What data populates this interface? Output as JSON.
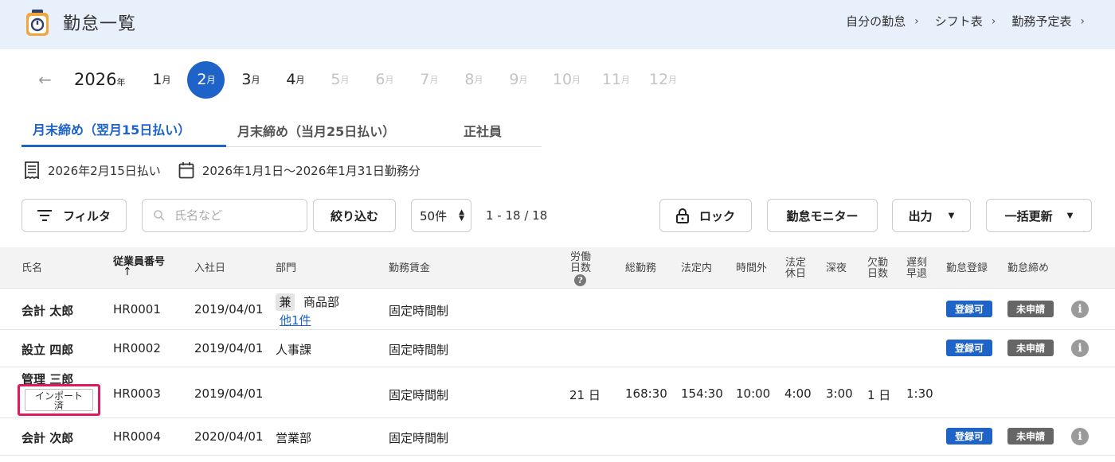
{
  "header": {
    "title": "勤怠一覧",
    "links": [
      {
        "label": "自分の勤怠"
      },
      {
        "label": "シフト表"
      },
      {
        "label": "勤務予定表"
      }
    ]
  },
  "months": {
    "year": "2026",
    "year_suffix": "年",
    "month_suffix": "月",
    "items": [
      "1",
      "2",
      "3",
      "4",
      "5",
      "6",
      "7",
      "8",
      "9",
      "10",
      "11",
      "12"
    ],
    "selected": "2"
  },
  "tabs": [
    {
      "label": "月末締め（翌月15日払い）",
      "active": true
    },
    {
      "label": "月末締め（当月25日払い）",
      "active": false
    },
    {
      "label": "正社員",
      "active": false
    }
  ],
  "info": {
    "payday": "2026年2月15日払い",
    "period": "2026年1月1日〜2026年1月31日勤務分"
  },
  "toolbar": {
    "filter_label": "フィルタ",
    "search_placeholder": "氏名など",
    "narrow_label": "絞り込む",
    "per_page": "50件",
    "range": "1 - 18 / 18",
    "lock_label": "ロック",
    "monitor_label": "勤怠モニター",
    "export_label": "出力",
    "bulk_label": "一括更新"
  },
  "table": {
    "headers": {
      "name": "氏名",
      "emp_no": "従業員番号",
      "sort_arrow": "↑",
      "hire_date": "入社日",
      "dept": "部門",
      "wage": "勤務賃金",
      "workdays_1": "労働",
      "workdays_2": "日数",
      "total": "総勤務",
      "legal": "法定内",
      "overtime": "時間外",
      "holiday_1": "法定",
      "holiday_2": "休日",
      "night": "深夜",
      "absence_1": "欠勤",
      "absence_2": "日数",
      "late_1": "遅刻",
      "late_2": "早退",
      "reg": "勤怠登録",
      "close": "勤怠締め"
    },
    "rows": [
      {
        "name": "会計 太郎",
        "emp_no": "HR0001",
        "hire_date": "2019/04/01",
        "dept_tag": "兼",
        "dept": "商品部",
        "dept_more": "他1件",
        "wage": "固定時間制",
        "reg": "登録可",
        "close": "未申請"
      },
      {
        "name": "設立 四郎",
        "emp_no": "HR0002",
        "hire_date": "2019/04/01",
        "dept": "人事課",
        "wage": "固定時間制",
        "reg": "登録可",
        "close": "未申請"
      },
      {
        "name": "管理 三郎",
        "import_1": "インポート",
        "import_2": "済",
        "emp_no": "HR0003",
        "hire_date": "2019/04/01",
        "wage": "固定時間制",
        "workdays": "21 日",
        "total": "168:30",
        "legal": "154:30",
        "overtime": "10:00",
        "holiday": "4:00",
        "night": "3:00",
        "absence": "1 日",
        "late": "1:30"
      },
      {
        "name": "会計 次郎",
        "emp_no": "HR0004",
        "hire_date": "2020/04/01",
        "dept": "営業部",
        "wage": "固定時間制",
        "reg": "登録可",
        "close": "未申請"
      }
    ]
  }
}
